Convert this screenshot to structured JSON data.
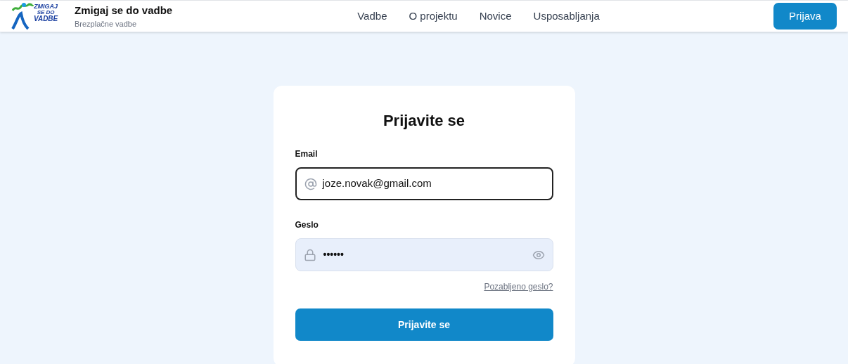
{
  "header": {
    "logo": {
      "line_1": "ZMIGAJ",
      "line_2": "SE DO",
      "line_3": "VADBE"
    },
    "title": "Zmigaj se do vadbe",
    "subtitle": "Brezplačne vadbe",
    "nav": [
      {
        "label": "Vadbe"
      },
      {
        "label": "O projektu"
      },
      {
        "label": "Novice"
      },
      {
        "label": "Usposabljanja"
      }
    ],
    "login_button": "Prijava"
  },
  "login_card": {
    "title": "Prijavite se",
    "email": {
      "label": "Email",
      "value": "joze.novak@gmail.com",
      "focused": true
    },
    "password": {
      "label": "Geslo",
      "value": "••••••"
    },
    "forgot_link": "Pozabljeno geslo?",
    "submit": "Prijavite se"
  }
}
